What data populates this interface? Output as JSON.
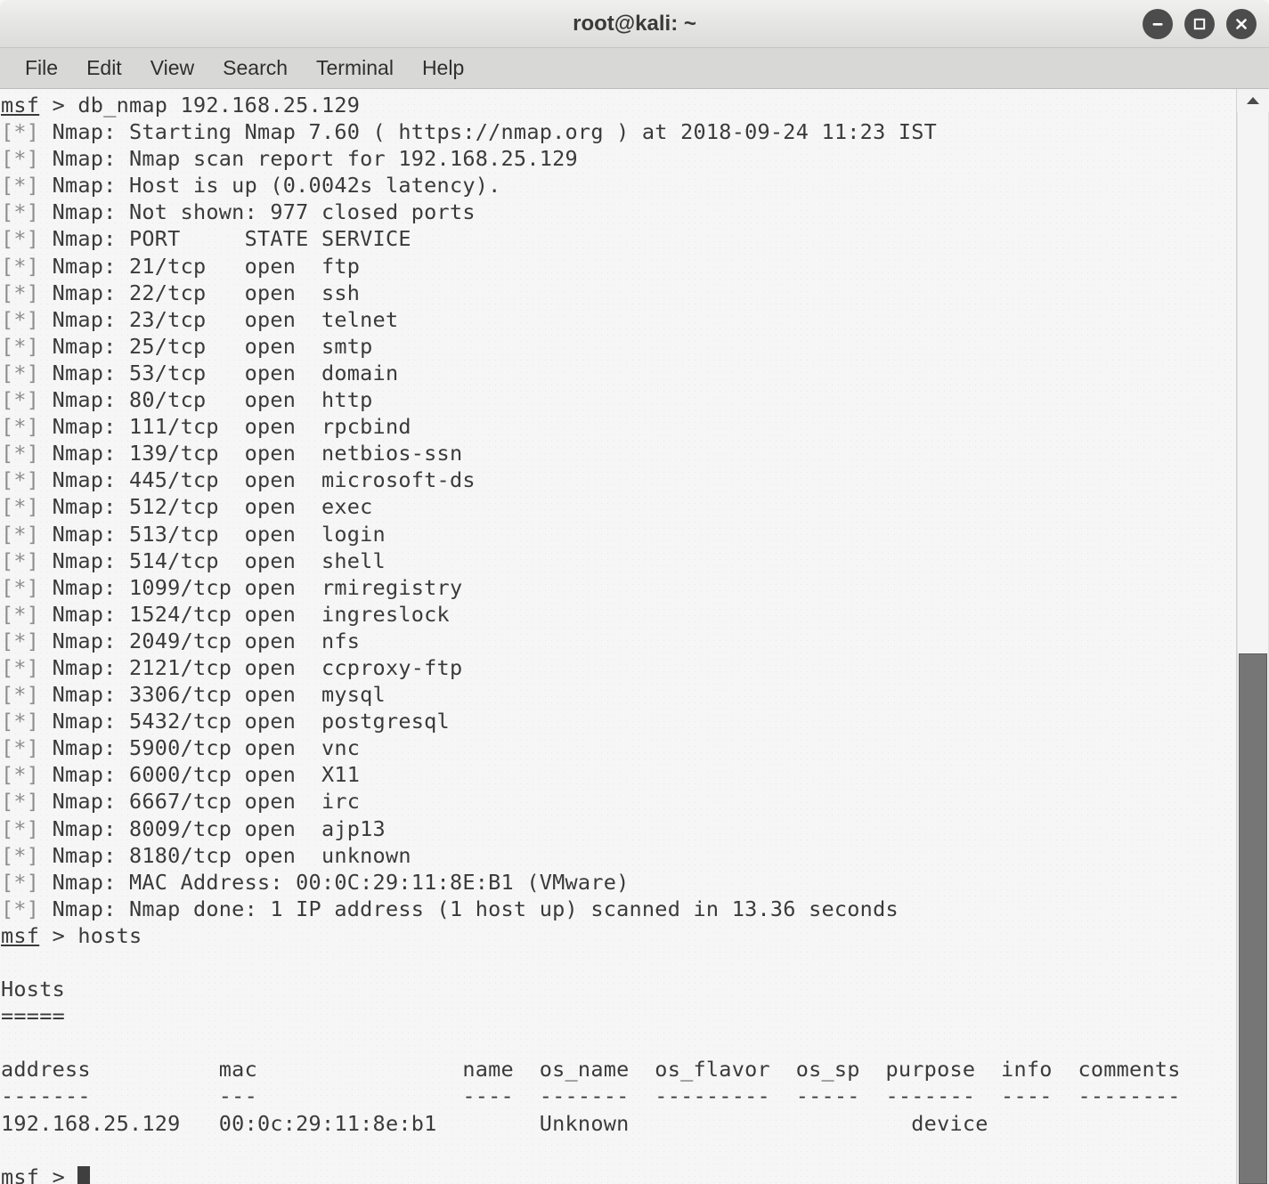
{
  "window": {
    "title": "root@kali: ~",
    "controls": [
      {
        "name": "minimize",
        "label": "Minimize"
      },
      {
        "name": "maximize",
        "label": "Maximize"
      },
      {
        "name": "close",
        "label": "Close"
      }
    ]
  },
  "menubar": {
    "items": [
      "File",
      "Edit",
      "View",
      "Search",
      "Terminal",
      "Help"
    ]
  },
  "terminal": {
    "prompt": "msf",
    "prompt_sep": " > ",
    "prefix": "[*]",
    "lines": [
      {
        "type": "prompt",
        "command": "db_nmap 192.168.25.129"
      },
      {
        "type": "output",
        "text": "Nmap: Starting Nmap 7.60 ( https://nmap.org ) at 2018-09-24 11:23 IST"
      },
      {
        "type": "output",
        "text": "Nmap: Nmap scan report for 192.168.25.129"
      },
      {
        "type": "output",
        "text": "Nmap: Host is up (0.0042s latency)."
      },
      {
        "type": "output",
        "text": "Nmap: Not shown: 977 closed ports"
      },
      {
        "type": "output",
        "text": "Nmap: PORT     STATE SERVICE"
      },
      {
        "type": "output",
        "text": "Nmap: 21/tcp   open  ftp"
      },
      {
        "type": "output",
        "text": "Nmap: 22/tcp   open  ssh"
      },
      {
        "type": "output",
        "text": "Nmap: 23/tcp   open  telnet"
      },
      {
        "type": "output",
        "text": "Nmap: 25/tcp   open  smtp"
      },
      {
        "type": "output",
        "text": "Nmap: 53/tcp   open  domain"
      },
      {
        "type": "output",
        "text": "Nmap: 80/tcp   open  http"
      },
      {
        "type": "output",
        "text": "Nmap: 111/tcp  open  rpcbind"
      },
      {
        "type": "output",
        "text": "Nmap: 139/tcp  open  netbios-ssn"
      },
      {
        "type": "output",
        "text": "Nmap: 445/tcp  open  microsoft-ds"
      },
      {
        "type": "output",
        "text": "Nmap: 512/tcp  open  exec"
      },
      {
        "type": "output",
        "text": "Nmap: 513/tcp  open  login"
      },
      {
        "type": "output",
        "text": "Nmap: 514/tcp  open  shell"
      },
      {
        "type": "output",
        "text": "Nmap: 1099/tcp open  rmiregistry"
      },
      {
        "type": "output",
        "text": "Nmap: 1524/tcp open  ingreslock"
      },
      {
        "type": "output",
        "text": "Nmap: 2049/tcp open  nfs"
      },
      {
        "type": "output",
        "text": "Nmap: 2121/tcp open  ccproxy-ftp"
      },
      {
        "type": "output",
        "text": "Nmap: 3306/tcp open  mysql"
      },
      {
        "type": "output",
        "text": "Nmap: 5432/tcp open  postgresql"
      },
      {
        "type": "output",
        "text": "Nmap: 5900/tcp open  vnc"
      },
      {
        "type": "output",
        "text": "Nmap: 6000/tcp open  X11"
      },
      {
        "type": "output",
        "text": "Nmap: 6667/tcp open  irc"
      },
      {
        "type": "output",
        "text": "Nmap: 8009/tcp open  ajp13"
      },
      {
        "type": "output",
        "text": "Nmap: 8180/tcp open  unknown"
      },
      {
        "type": "output",
        "text": "Nmap: MAC Address: 00:0C:29:11:8E:B1 (VMware)"
      },
      {
        "type": "output",
        "text": "Nmap: Nmap done: 1 IP address (1 host up) scanned in 13.36 seconds"
      },
      {
        "type": "prompt",
        "command": "hosts"
      },
      {
        "type": "plain",
        "text": ""
      },
      {
        "type": "plain",
        "text": "Hosts"
      },
      {
        "type": "plain",
        "text": "====="
      },
      {
        "type": "plain",
        "text": ""
      },
      {
        "type": "plain",
        "text": "address          mac                name  os_name  os_flavor  os_sp  purpose  info  comments"
      },
      {
        "type": "plain",
        "text": "-------          ---                ----  -------  ---------  -----  -------  ----  --------"
      },
      {
        "type": "plain",
        "text": "192.168.25.129   00:0c:29:11:8e:b1        Unknown                      device"
      },
      {
        "type": "plain",
        "text": ""
      },
      {
        "type": "cursor",
        "command": ""
      }
    ],
    "scan": {
      "nmap_version": "7.60",
      "nmap_url": "https://nmap.org",
      "scan_date": "2018-09-24",
      "scan_time": "11:23",
      "timezone": "IST",
      "target": "192.168.25.129",
      "latency": "0.0042s",
      "closed_ports": "977",
      "duration_seconds": "13.36",
      "hosts_up": "1",
      "mac_address": "00:0C:29:11:8E:B1",
      "mac_vendor": "VMware",
      "port_columns": [
        "PORT",
        "STATE",
        "SERVICE"
      ],
      "ports": [
        {
          "port": "21/tcp",
          "state": "open",
          "service": "ftp"
        },
        {
          "port": "22/tcp",
          "state": "open",
          "service": "ssh"
        },
        {
          "port": "23/tcp",
          "state": "open",
          "service": "telnet"
        },
        {
          "port": "25/tcp",
          "state": "open",
          "service": "smtp"
        },
        {
          "port": "53/tcp",
          "state": "open",
          "service": "domain"
        },
        {
          "port": "80/tcp",
          "state": "open",
          "service": "http"
        },
        {
          "port": "111/tcp",
          "state": "open",
          "service": "rpcbind"
        },
        {
          "port": "139/tcp",
          "state": "open",
          "service": "netbios-ssn"
        },
        {
          "port": "445/tcp",
          "state": "open",
          "service": "microsoft-ds"
        },
        {
          "port": "512/tcp",
          "state": "open",
          "service": "exec"
        },
        {
          "port": "513/tcp",
          "state": "open",
          "service": "login"
        },
        {
          "port": "514/tcp",
          "state": "open",
          "service": "shell"
        },
        {
          "port": "1099/tcp",
          "state": "open",
          "service": "rmiregistry"
        },
        {
          "port": "1524/tcp",
          "state": "open",
          "service": "ingreslock"
        },
        {
          "port": "2049/tcp",
          "state": "open",
          "service": "nfs"
        },
        {
          "port": "2121/tcp",
          "state": "open",
          "service": "ccproxy-ftp"
        },
        {
          "port": "3306/tcp",
          "state": "open",
          "service": "mysql"
        },
        {
          "port": "5432/tcp",
          "state": "open",
          "service": "postgresql"
        },
        {
          "port": "5900/tcp",
          "state": "open",
          "service": "vnc"
        },
        {
          "port": "6000/tcp",
          "state": "open",
          "service": "X11"
        },
        {
          "port": "6667/tcp",
          "state": "open",
          "service": "irc"
        },
        {
          "port": "8009/tcp",
          "state": "open",
          "service": "ajp13"
        },
        {
          "port": "8180/tcp",
          "state": "open",
          "service": "unknown"
        }
      ]
    },
    "hosts_table": {
      "heading": "Hosts",
      "heading_rule": "=====",
      "columns": [
        "address",
        "mac",
        "name",
        "os_name",
        "os_flavor",
        "os_sp",
        "purpose",
        "info",
        "comments"
      ],
      "rows": [
        {
          "address": "192.168.25.129",
          "mac": "00:0c:29:11:8e:b1",
          "name": "",
          "os_name": "Unknown",
          "os_flavor": "",
          "os_sp": "",
          "purpose": "device",
          "info": "",
          "comments": ""
        }
      ]
    }
  },
  "scrollbar": {
    "thumb_top_pct": 50.5,
    "thumb_height_pct": 49.5
  },
  "colors": {
    "terminal_bg": "#f6f6f7",
    "terminal_fg": "#3a3a3a",
    "dim_fg": "#8d8d8d",
    "titlebar_bg": "#e6e6e4",
    "menubar_bg": "#d8d8d6",
    "control_btn": "#4c4c4c",
    "scrollbar_thumb": "#767676"
  }
}
